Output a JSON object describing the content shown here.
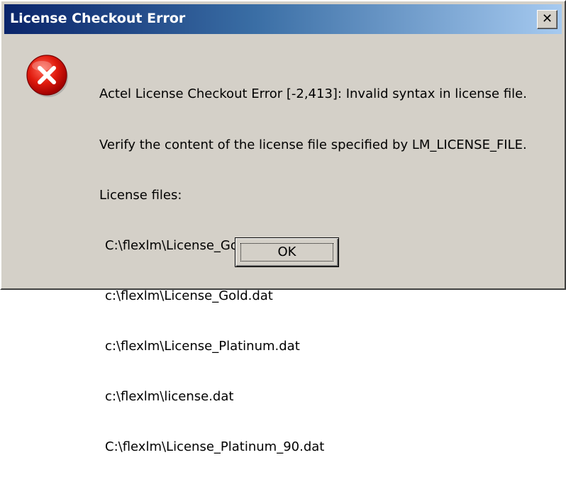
{
  "window": {
    "title": "License Checkout Error",
    "close_glyph": "✕"
  },
  "icon": {
    "name": "error-icon",
    "color": "#cc0000"
  },
  "message": {
    "line1": "Actel License Checkout Error [-2,413]: Invalid syntax in license file.",
    "line2": "Verify the content of the license file specified by LM_LICENSE_FILE.",
    "line3": "License files:",
    "files": [
      "C:\\flexlm\\License_Gold_new.dat",
      "c:\\flexlm\\License_Gold.dat",
      "c:\\flexlm\\License_Platinum.dat",
      "c:\\flexlm\\license.dat",
      "C:\\flexlm\\License_Platinum_90.dat"
    ]
  },
  "buttons": {
    "ok_label": "OK"
  },
  "colors": {
    "dialog_bg": "#d4d0c8",
    "titlebar_start": "#0a246a",
    "titlebar_end": "#a6caf0"
  }
}
